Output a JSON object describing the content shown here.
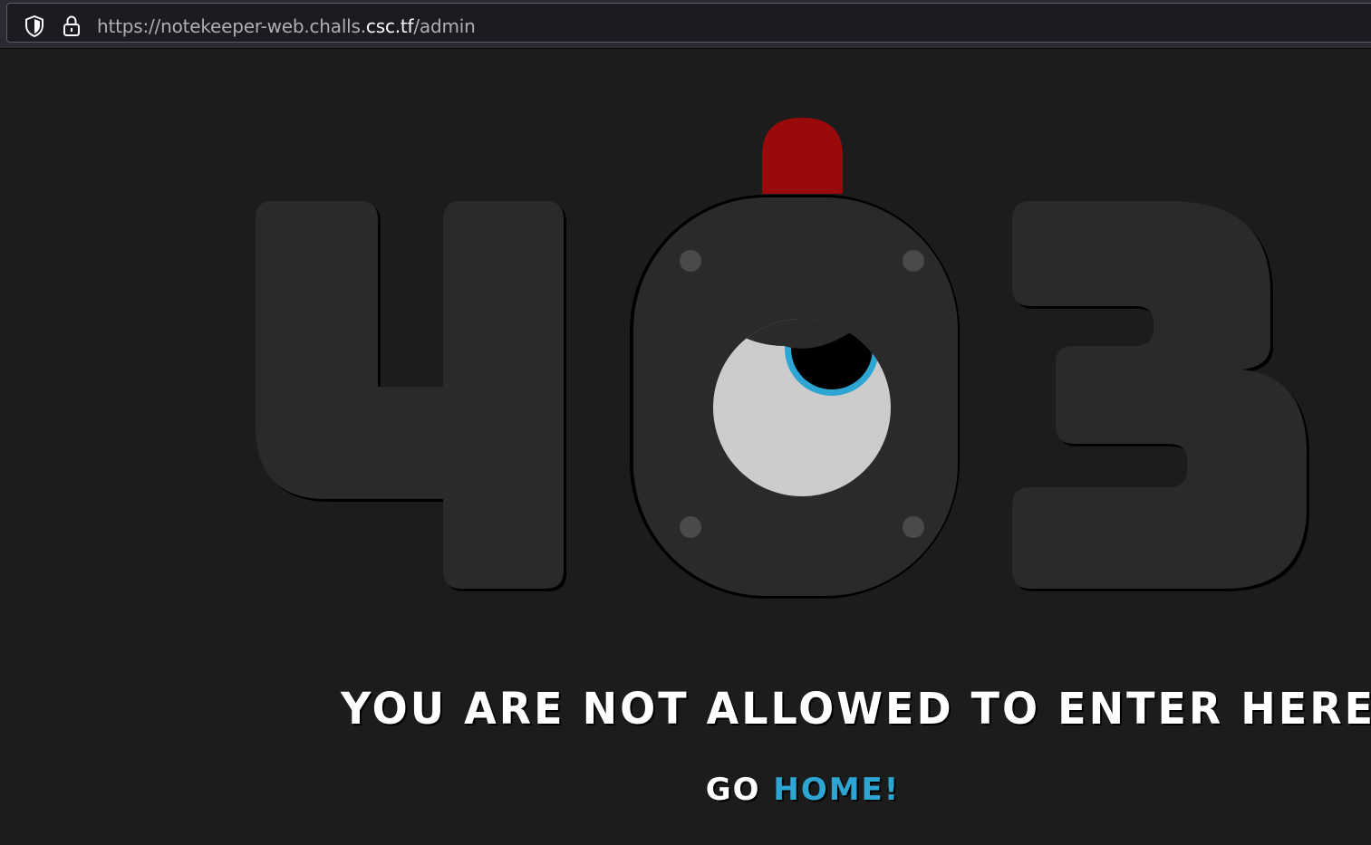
{
  "browser": {
    "url_prefix": "https://notekeeper-web.challs.",
    "url_host": "csc.tf",
    "url_path": "/admin"
  },
  "page": {
    "error_code": "403",
    "message": "YOU ARE NOT ALLOWED TO ENTER HERE",
    "go_label": "GO",
    "home_link": "HOME!"
  },
  "colors": {
    "background": "#1c1c1c",
    "digit": "#2a2a2a",
    "alarm": "#9b0a0a",
    "eye": "#cccccc",
    "iris": "#2ea6d4",
    "link": "#2ea6d4"
  }
}
